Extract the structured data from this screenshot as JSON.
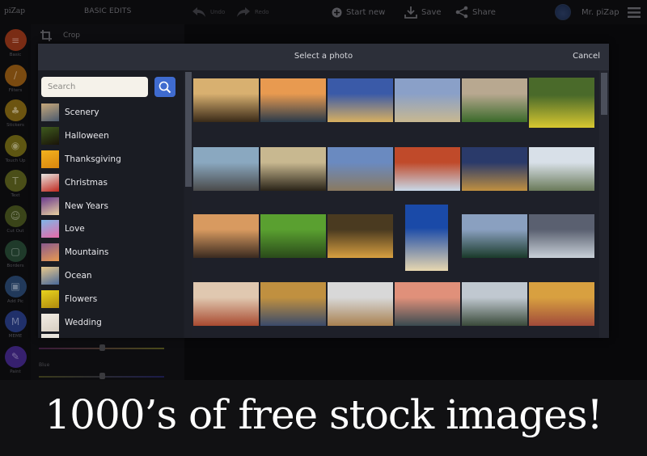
{
  "app": {
    "logo": "piZap",
    "section_title": "BASIC EDITS",
    "toolbar": {
      "undo": "Undo",
      "redo": "Redo",
      "start_new": "Start new",
      "save": "Save",
      "share": "Share",
      "user_name": "Mr. piZap"
    },
    "rail": [
      {
        "label": "Basic",
        "icon": "sliders-icon",
        "color": "#7a2c14"
      },
      {
        "label": "Filters",
        "icon": "magic-wand-icon",
        "color": "#7a4a10"
      },
      {
        "label": "Stickers",
        "icon": "stickers-icon",
        "color": "#6c5410"
      },
      {
        "label": "Touch Up",
        "icon": "eye-icon",
        "color": "#5e5612"
      },
      {
        "label": "Text",
        "icon": "text-icon",
        "color": "#4a4e18"
      },
      {
        "label": "Cut Out",
        "icon": "person-cutout-icon",
        "color": "#3a4419"
      },
      {
        "label": "Borders",
        "icon": "border-frame-icon",
        "color": "#1f3a2a"
      },
      {
        "label": "Add Pic",
        "icon": "add-picture-icon",
        "color": "#21395a"
      },
      {
        "label": "MEME",
        "icon": "meme-icon",
        "color": "#20306a"
      },
      {
        "label": "Paint",
        "icon": "paintbrush-icon",
        "color": "#36206e"
      }
    ],
    "crop_label": "Crop",
    "blue_label": "Blue"
  },
  "modal": {
    "title": "Select a photo",
    "cancel": "Cancel",
    "search_placeholder": "Search",
    "search_value": "",
    "categories": [
      {
        "label": "Scenery",
        "thumb": [
          "#c7a87a",
          "#4a5a6e"
        ]
      },
      {
        "label": "Halloween",
        "thumb": [
          "#3e5a1e",
          "#1a1408"
        ]
      },
      {
        "label": "Thanksgiving",
        "thumb": [
          "#f2b21e",
          "#d8860e"
        ]
      },
      {
        "label": "Christmas",
        "thumb": [
          "#e8e6e2",
          "#c0281e"
        ]
      },
      {
        "label": "New Years",
        "thumb": [
          "#6a3a8e",
          "#e8d0a0"
        ]
      },
      {
        "label": "Love",
        "thumb": [
          "#7fb6e8",
          "#e86aa8"
        ]
      },
      {
        "label": "Mountains",
        "thumb": [
          "#8a5a8e",
          "#e89a50"
        ]
      },
      {
        "label": "Ocean",
        "thumb": [
          "#e8c88a",
          "#4a6a9a"
        ]
      },
      {
        "label": "Flowers",
        "thumb": [
          "#e8d41e",
          "#b08a0e"
        ]
      },
      {
        "label": "Wedding",
        "thumb": [
          "#f2ece4",
          "#d8cfc2"
        ]
      }
    ],
    "photos": [
      {
        "name": "forest-sunlight",
        "c": [
          "#d8b070",
          "#3a2a18"
        ]
      },
      {
        "name": "beach-gate-sunset",
        "c": [
          "#e89a50",
          "#2a3a4a"
        ]
      },
      {
        "name": "parliament-night",
        "c": [
          "#3a5aa8",
          "#d8b060"
        ]
      },
      {
        "name": "blossom-branches",
        "c": [
          "#8aa0c8",
          "#c8b890"
        ]
      },
      {
        "name": "boat-in-field",
        "c": [
          "#b8a890",
          "#3a6a2a"
        ]
      },
      {
        "name": "forest-path-flowers",
        "c": [
          "#4a6a2a",
          "#d8c830"
        ]
      },
      {
        "name": "blue-burst",
        "c": [
          "#8aa8c0",
          "#4a4a4a"
        ]
      },
      {
        "name": "misty-forest-deer",
        "c": [
          "#c8b890",
          "#2a2418"
        ]
      },
      {
        "name": "railroad-tracks",
        "c": [
          "#6a8ac0",
          "#8a7a60"
        ]
      },
      {
        "name": "red-sky-ice",
        "c": [
          "#c04a2a",
          "#c8d8e8"
        ]
      },
      {
        "name": "city-night-towers",
        "c": [
          "#2a3a6a",
          "#c09040"
        ]
      },
      {
        "name": "mountain-lake-reflection",
        "c": [
          "#d8e0e8",
          "#6a7a5a"
        ]
      },
      {
        "name": "lake-sunset",
        "c": [
          "#d89a60",
          "#3a2a20"
        ]
      },
      {
        "name": "green-meadow-trees",
        "c": [
          "#5aa030",
          "#2a4a1a"
        ]
      },
      {
        "name": "dark-forest-light",
        "c": [
          "#4a3a20",
          "#d8a040"
        ]
      },
      {
        "name": "lighthouse-blue-sky",
        "c": [
          "#1a4aa8",
          "#e8d8b0"
        ]
      },
      {
        "name": "snowy-mountain-forest",
        "c": [
          "#8aa0c0",
          "#1a3a2a"
        ]
      },
      {
        "name": "waterfall-dramatic-sky",
        "c": [
          "#5a6070",
          "#c8d0d8"
        ]
      },
      {
        "name": "autumn-foggy-forest",
        "c": [
          "#e0c8b0",
          "#a84a30"
        ]
      },
      {
        "name": "wooden-pier",
        "c": [
          "#c09040",
          "#3a4a6a"
        ]
      },
      {
        "name": "sand-dunes-lake",
        "c": [
          "#d8d8d8",
          "#a88050"
        ]
      },
      {
        "name": "pink-lake-mountains",
        "c": [
          "#e0907a",
          "#3a4a50"
        ]
      },
      {
        "name": "rocky-river",
        "c": [
          "#c0c8d0",
          "#3a4a3a"
        ]
      },
      {
        "name": "rainbow-mountains",
        "c": [
          "#d8a040",
          "#a04a3a"
        ]
      }
    ]
  },
  "caption": "1000’s of free stock images!"
}
